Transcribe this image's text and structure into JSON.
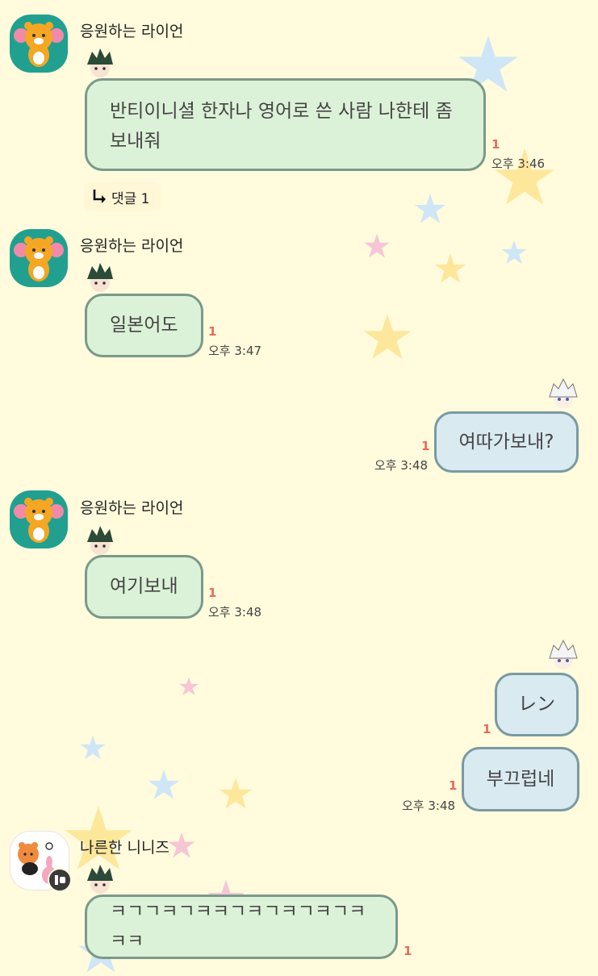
{
  "messages": [
    {
      "sender": "응원하는 라이언",
      "text_lines": [
        "반티이니셜 한자나 영어로 쓴 사람 나한테 좀",
        "보내줘"
      ],
      "unread": "1",
      "time": "오후 3:46",
      "reply_label": "댓글 1"
    },
    {
      "sender": "응원하는 라이언",
      "text": "일본어도",
      "unread": "1",
      "time": "오후 3:47"
    },
    {
      "text": "여따가보내?",
      "unread": "1",
      "time": "오후 3:48"
    },
    {
      "sender": "응원하는 라이언",
      "text": "여기보내",
      "unread": "1",
      "time": "오후 3:48"
    },
    {
      "text": "レン",
      "unread": "1"
    },
    {
      "text": "부끄럽네",
      "unread": "1",
      "time": "오후 3:48"
    },
    {
      "sender": "나른한 니니즈",
      "text": "ㅋㄱㄱㅋㄱㅋㅋㄱㅋㄱㅋㄱㅋㄱㅋㅋㅋ",
      "unread": "1"
    }
  ],
  "icons": {
    "reply": "reply-arrow-icon",
    "ryan_avatar": "ryan-cheerleader-avatar",
    "ninizz_avatar": "ninizz-avatar",
    "boy_peek": "dark-haired-boy-sticker",
    "white_peek": "white-haired-boy-sticker"
  },
  "colors": {
    "background": "#fffbdc",
    "incoming_bubble": "#dcf2d8",
    "outgoing_bubble": "#d9eaf1",
    "unread": "#e86a5a",
    "avatar_bg": "#22a08f"
  }
}
